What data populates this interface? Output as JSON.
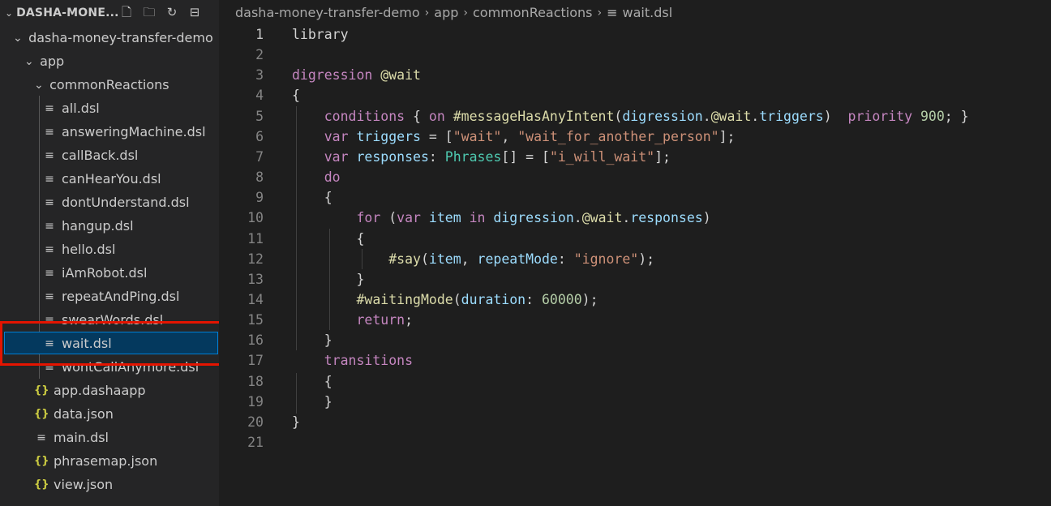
{
  "sidebar": {
    "title": "DASHA-MONE...",
    "actions": [
      "new-file-icon",
      "new-folder-icon",
      "refresh-icon",
      "collapse-all-icon"
    ],
    "tree": [
      {
        "label": "dasha-money-transfer-demo",
        "kind": "folder",
        "depth": 0,
        "open": true
      },
      {
        "label": "app",
        "kind": "folder",
        "depth": 1,
        "open": true
      },
      {
        "label": "commonReactions",
        "kind": "folder",
        "depth": 2,
        "open": true
      },
      {
        "label": "all.dsl",
        "kind": "dsl",
        "depth": 3
      },
      {
        "label": "answeringMachine.dsl",
        "kind": "dsl",
        "depth": 3
      },
      {
        "label": "callBack.dsl",
        "kind": "dsl",
        "depth": 3
      },
      {
        "label": "canHearYou.dsl",
        "kind": "dsl",
        "depth": 3
      },
      {
        "label": "dontUnderstand.dsl",
        "kind": "dsl",
        "depth": 3
      },
      {
        "label": "hangup.dsl",
        "kind": "dsl",
        "depth": 3
      },
      {
        "label": "hello.dsl",
        "kind": "dsl",
        "depth": 3
      },
      {
        "label": "iAmRobot.dsl",
        "kind": "dsl",
        "depth": 3
      },
      {
        "label": "repeatAndPing.dsl",
        "kind": "dsl",
        "depth": 3
      },
      {
        "label": "swearWords.dsl",
        "kind": "dsl",
        "depth": 3
      },
      {
        "label": "wait.dsl",
        "kind": "dsl",
        "depth": 3,
        "selected": true
      },
      {
        "label": "wontCallAnymore.dsl",
        "kind": "dsl",
        "depth": 3
      },
      {
        "label": "app.dashaapp",
        "kind": "json",
        "depth": 2
      },
      {
        "label": "data.json",
        "kind": "json",
        "depth": 2
      },
      {
        "label": "main.dsl",
        "kind": "dsl",
        "depth": 2
      },
      {
        "label": "phrasemap.json",
        "kind": "json",
        "depth": 2
      },
      {
        "label": "view.json",
        "kind": "json",
        "depth": 2
      }
    ]
  },
  "breadcrumb": [
    "dasha-money-transfer-demo",
    "app",
    "commonReactions",
    "wait.dsl"
  ],
  "editor": {
    "active_line": 1,
    "lines": [
      [
        [
          "library",
          "d"
        ]
      ],
      [],
      [
        [
          "digression ",
          "kw"
        ],
        [
          "@wait",
          "fn"
        ]
      ],
      [
        [
          "{",
          "d"
        ]
      ],
      [
        [
          "    ",
          "d"
        ],
        [
          "conditions",
          "kw"
        ],
        [
          " { ",
          "d"
        ],
        [
          "on",
          "kw"
        ],
        [
          " ",
          "d"
        ],
        [
          "#messageHasAnyIntent",
          "fn"
        ],
        [
          "(",
          "d"
        ],
        [
          "digression",
          "var"
        ],
        [
          ".",
          "d"
        ],
        [
          "@wait",
          "fn"
        ],
        [
          ".",
          "d"
        ],
        [
          "triggers",
          "var"
        ],
        [
          ")  ",
          "d"
        ],
        [
          "priority",
          "kw"
        ],
        [
          " ",
          "d"
        ],
        [
          "900",
          "num"
        ],
        [
          "; }",
          "d"
        ]
      ],
      [
        [
          "    ",
          "d"
        ],
        [
          "var",
          "kw"
        ],
        [
          " ",
          "d"
        ],
        [
          "triggers",
          "var"
        ],
        [
          " = [",
          "d"
        ],
        [
          "\"wait\"",
          "str"
        ],
        [
          ", ",
          "d"
        ],
        [
          "\"wait_for_another_person\"",
          "str"
        ],
        [
          "];",
          "d"
        ]
      ],
      [
        [
          "    ",
          "d"
        ],
        [
          "var",
          "kw"
        ],
        [
          " ",
          "d"
        ],
        [
          "responses",
          "var"
        ],
        [
          ": ",
          "d"
        ],
        [
          "Phrases",
          "typ"
        ],
        [
          "[] = [",
          "d"
        ],
        [
          "\"i_will_wait\"",
          "str"
        ],
        [
          "];",
          "d"
        ]
      ],
      [
        [
          "    ",
          "d"
        ],
        [
          "do",
          "kw"
        ]
      ],
      [
        [
          "    {",
          "d"
        ]
      ],
      [
        [
          "        ",
          "d"
        ],
        [
          "for",
          "kw"
        ],
        [
          " (",
          "d"
        ],
        [
          "var",
          "kw"
        ],
        [
          " ",
          "d"
        ],
        [
          "item",
          "var"
        ],
        [
          " ",
          "d"
        ],
        [
          "in",
          "kw"
        ],
        [
          " ",
          "d"
        ],
        [
          "digression",
          "var"
        ],
        [
          ".",
          "d"
        ],
        [
          "@wait",
          "fn"
        ],
        [
          ".",
          "d"
        ],
        [
          "responses",
          "var"
        ],
        [
          ")",
          "d"
        ]
      ],
      [
        [
          "        {",
          "d"
        ]
      ],
      [
        [
          "            ",
          "d"
        ],
        [
          "#say",
          "fn"
        ],
        [
          "(",
          "d"
        ],
        [
          "item",
          "var"
        ],
        [
          ", ",
          "d"
        ],
        [
          "repeatMode",
          "var"
        ],
        [
          ": ",
          "d"
        ],
        [
          "\"ignore\"",
          "str"
        ],
        [
          ");",
          "d"
        ]
      ],
      [
        [
          "        }",
          "d"
        ]
      ],
      [
        [
          "        ",
          "d"
        ],
        [
          "#waitingMode",
          "fn"
        ],
        [
          "(",
          "d"
        ],
        [
          "duration",
          "var"
        ],
        [
          ": ",
          "d"
        ],
        [
          "60000",
          "num"
        ],
        [
          ");",
          "d"
        ]
      ],
      [
        [
          "        ",
          "d"
        ],
        [
          "return",
          "kw"
        ],
        [
          ";",
          "d"
        ]
      ],
      [
        [
          "    }",
          "d"
        ]
      ],
      [
        [
          "    ",
          "d"
        ],
        [
          "transitions",
          "kw"
        ]
      ],
      [
        [
          "    {",
          "d"
        ]
      ],
      [
        [
          "    }",
          "d"
        ]
      ],
      [
        [
          "}",
          "d"
        ]
      ],
      []
    ]
  }
}
